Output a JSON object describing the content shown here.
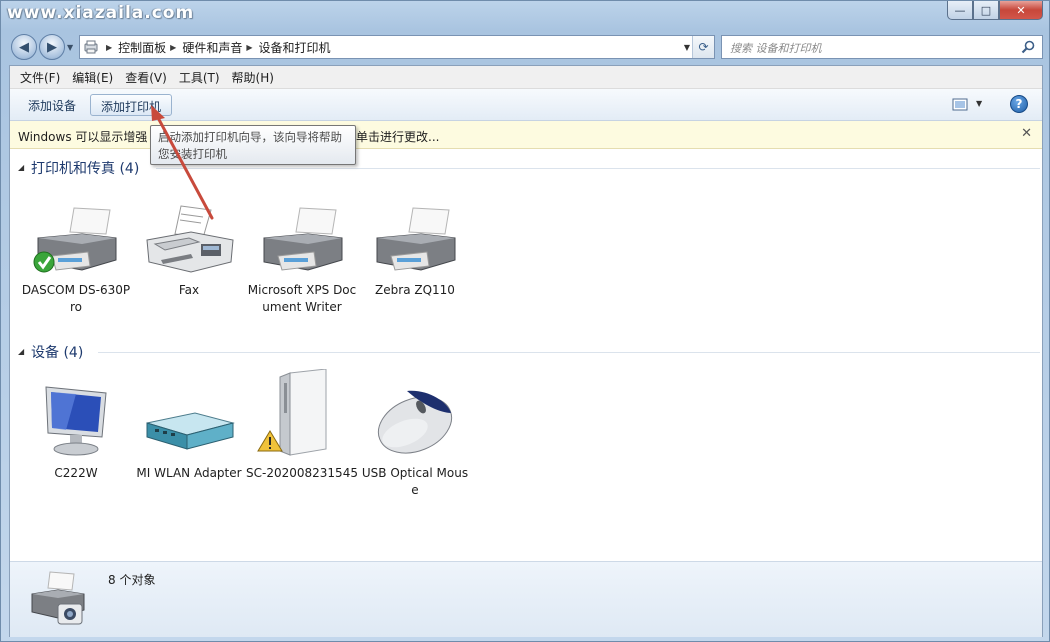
{
  "window": {
    "watermark": "www.xiazaila.com",
    "minimize_glyph": "—",
    "maximize_glyph": "□",
    "close_glyph": "✕"
  },
  "nav": {
    "back_glyph": "◀",
    "forward_glyph": "▶",
    "breadcrumbs": [
      "控制面板",
      "硬件和声音",
      "设备和打印机"
    ],
    "search_placeholder": "搜索 设备和打印机"
  },
  "menu": [
    "文件(F)",
    "编辑(E)",
    "查看(V)",
    "工具(T)",
    "帮助(H)"
  ],
  "toolbar": {
    "add_device": "添加设备",
    "add_printer": "添加打印机"
  },
  "infobar": {
    "text_left": "Windows 可以显示增强",
    "text_right": "单击进行更改...",
    "close_glyph": "✕"
  },
  "tooltip": {
    "line1": "启动添加打印机向导，该向导将帮助",
    "line2": "您安装打印机"
  },
  "groups": [
    {
      "title": "打印机和传真 (4)",
      "items": [
        {
          "label": "DASCOM DS-630Pro",
          "icon": "printer-icon",
          "default": true
        },
        {
          "label": "Fax",
          "icon": "fax-icon",
          "default": false
        },
        {
          "label": "Microsoft XPS Document Writer",
          "icon": "printer-icon",
          "default": false
        },
        {
          "label": "Zebra ZQ110",
          "icon": "printer-icon",
          "default": false
        }
      ]
    },
    {
      "title": "设备 (4)",
      "items": [
        {
          "label": "C222W",
          "icon": "monitor-icon"
        },
        {
          "label": "MI WLAN Adapter",
          "icon": "network-adapter-icon"
        },
        {
          "label": "SC-202008231545",
          "icon": "computer-tower-icon",
          "warning": true
        },
        {
          "label": "USB Optical Mouse",
          "icon": "mouse-icon"
        }
      ]
    }
  ],
  "status": {
    "count_text": "8 个对象"
  },
  "colors": {
    "accent": "#1e3a6e",
    "infobar_bg": "#fdfbe0",
    "arrow": "#c84a3c"
  }
}
